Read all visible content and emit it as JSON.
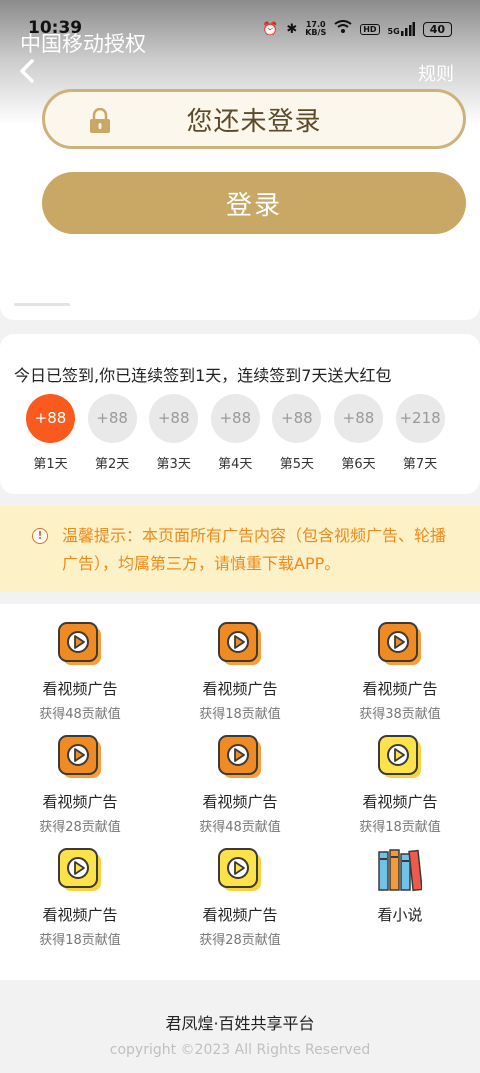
{
  "status_bar": {
    "time": "10:39",
    "speed_value": "17.0",
    "speed_unit": "KB/S",
    "hd": "HD",
    "network": "5G",
    "battery": "40"
  },
  "header": {
    "carrier": "中国移动授权",
    "rules_label": "规则"
  },
  "login": {
    "status_text": "您还未登录",
    "button_label": "登录"
  },
  "signin": {
    "message": "今日已签到,你已连续签到1天，连续签到7天送大红包",
    "days": [
      {
        "reward": "+88",
        "label": "第1天"
      },
      {
        "reward": "+88",
        "label": "第2天"
      },
      {
        "reward": "+88",
        "label": "第3天"
      },
      {
        "reward": "+88",
        "label": "第4天"
      },
      {
        "reward": "+88",
        "label": "第5天"
      },
      {
        "reward": "+88",
        "label": "第6天"
      },
      {
        "reward": "+218",
        "label": "第7天"
      }
    ]
  },
  "notice": {
    "icon": "!",
    "text": "温馨提示：本页面所有广告内容（包含视频广告、轮播广告），均属第三方，请慎重下载APP。"
  },
  "tasks": [
    {
      "title": "看视频广告",
      "sub": "获得48贡献值",
      "icon": "orange-play-icon"
    },
    {
      "title": "看视频广告",
      "sub": "获得18贡献值",
      "icon": "orange-play-icon"
    },
    {
      "title": "看视频广告",
      "sub": "获得38贡献值",
      "icon": "orange-play-icon"
    },
    {
      "title": "看视频广告",
      "sub": "获得28贡献值",
      "icon": "orange-play-icon"
    },
    {
      "title": "看视频广告",
      "sub": "获得48贡献值",
      "icon": "orange-play-icon"
    },
    {
      "title": "看视频广告",
      "sub": "获得18贡献值",
      "icon": "yellow-play-icon"
    },
    {
      "title": "看视频广告",
      "sub": "获得18贡献值",
      "icon": "yellow-play-icon"
    },
    {
      "title": "看视频广告",
      "sub": "获得28贡献值",
      "icon": "yellow-play-icon"
    },
    {
      "title": "看小说",
      "sub": "",
      "icon": "books-icon"
    }
  ],
  "footer": {
    "brand": "君凤煌·百姓共享平台",
    "copyright": "copyright ©2023 All Rights Reserved"
  },
  "colors": {
    "gold": "#c8a864",
    "active_day": "#fa5a1e",
    "notice_bg": "#fdf1c7",
    "notice_text": "#ef8a1c"
  }
}
